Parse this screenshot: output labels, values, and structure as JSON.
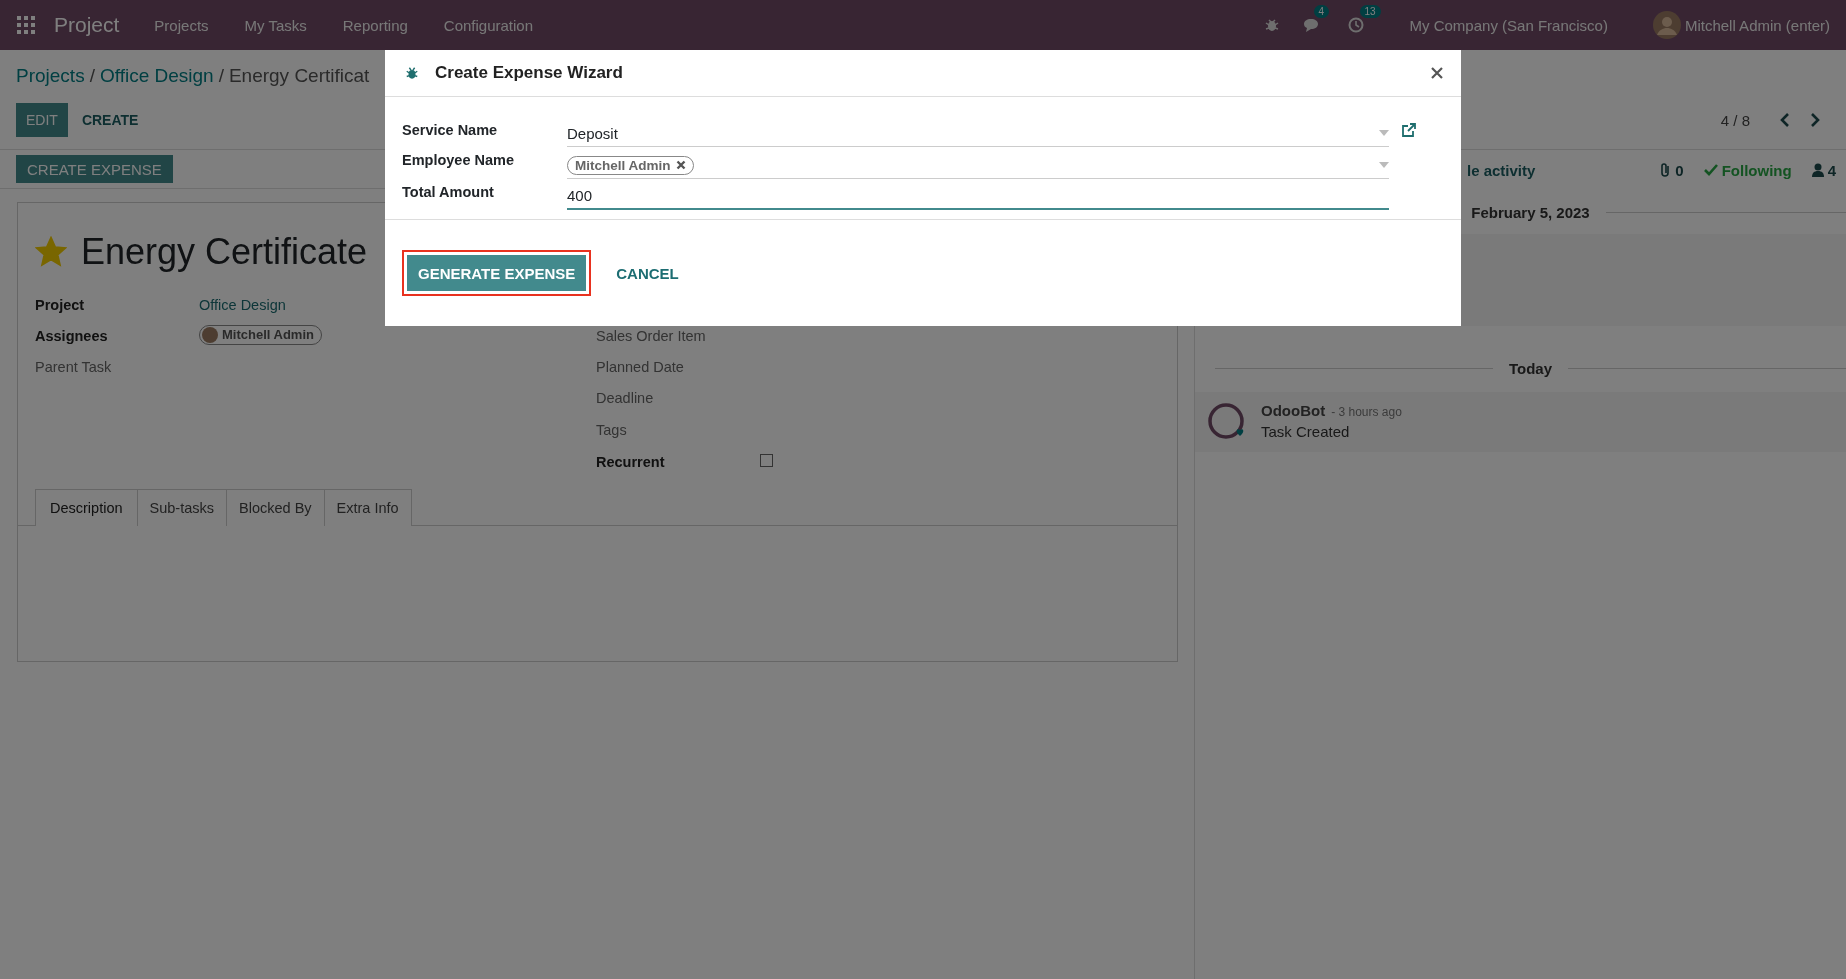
{
  "top_bar": {
    "app_name": "Project",
    "menu": [
      "Projects",
      "My Tasks",
      "Reporting",
      "Configuration"
    ],
    "chat_count": "4",
    "activity_count": "13",
    "company": "My Company (San Francisco)",
    "user": "Mitchell Admin (enter)"
  },
  "breadcrumbs": [
    {
      "kind": "link",
      "text": "Projects"
    },
    {
      "kind": "separator",
      "text": "/"
    },
    {
      "kind": "link",
      "text": "Office Design"
    },
    {
      "kind": "separator",
      "text": "/"
    },
    {
      "kind": "current",
      "text": "Energy Certificat"
    }
  ],
  "control_panel": {
    "buttons": [
      {
        "label": "EDIT",
        "kind": "primary"
      },
      {
        "label": "CREATE",
        "kind": "secondary"
      }
    ],
    "pager": "4 / 8"
  },
  "header_buttons": [
    "CREATE EXPENSE"
  ],
  "task": {
    "starred": true,
    "title": "Energy Certificate",
    "fields_left": [
      {
        "label": "Project",
        "emphasized": true,
        "kind": "link",
        "value": "Office Design"
      },
      {
        "label": "Assignees",
        "emphasized": true,
        "kind": "tag",
        "value": "Mitchell Admin"
      },
      {
        "label": "Parent Task",
        "emphasized": false,
        "kind": "empty"
      }
    ],
    "fields_right": [
      {
        "label": "Sales Order Item",
        "emphasized": false,
        "kind": "empty"
      },
      {
        "label": "Planned Date",
        "emphasized": false,
        "kind": "empty"
      },
      {
        "label": "Deadline",
        "emphasized": false,
        "kind": "empty"
      },
      {
        "label": "Tags",
        "emphasized": false,
        "kind": "empty"
      },
      {
        "label": "Recurrent",
        "emphasized": true,
        "kind": "checkbox",
        "checked": false
      }
    ],
    "tabs": [
      {
        "label": "Description",
        "selected": true
      },
      {
        "label": "Sub-tasks",
        "selected": false
      },
      {
        "label": "Blocked By",
        "selected": false
      },
      {
        "label": "Extra Info",
        "selected": false
      }
    ]
  },
  "chatter": {
    "schedule_activity": "le activity",
    "attachments": "0",
    "following": "Following",
    "followers": "4",
    "timeline": [
      {
        "kind": "date",
        "label": "February 5, 2023"
      },
      {
        "kind": "date",
        "label": "Today"
      },
      {
        "kind": "message",
        "author": "OdooBot",
        "time": "- 3 hours ago",
        "body": "Task Created"
      }
    ]
  },
  "dialog": {
    "title": "Create Expense Wizard",
    "fields": [
      {
        "label": "Service Name",
        "kind": "many2one",
        "value": "Deposit",
        "focused": false
      },
      {
        "label": "Employee Name",
        "kind": "tags",
        "tags": [
          "Mitchell Admin"
        ],
        "focused": false
      },
      {
        "label": "Total Amount",
        "kind": "input",
        "value": "400",
        "focused": true
      }
    ],
    "buttons": [
      {
        "label": "GENERATE EXPENSE",
        "kind": "primary",
        "highlighted": true
      },
      {
        "label": "CANCEL",
        "kind": "link",
        "highlighted": false
      }
    ]
  }
}
